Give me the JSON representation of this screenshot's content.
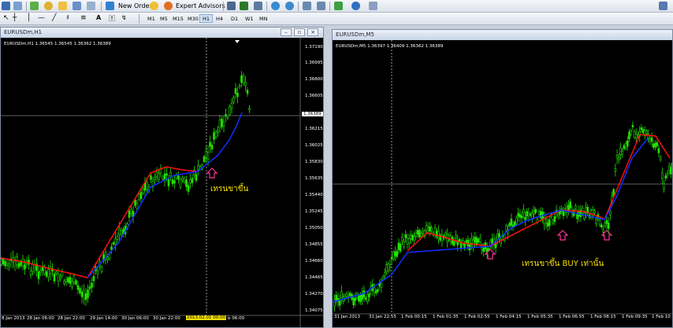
{
  "toolbar": {
    "new_order_label": "New Order",
    "expert_advisors_label": "Expert Advisors",
    "timeframes": [
      "M1",
      "M5",
      "M15",
      "M30",
      "H1",
      "H4",
      "D1",
      "W1",
      "MN"
    ]
  },
  "left_window": {
    "title": "EURUSDm,H1",
    "info": "EURUSDm,H1  1.36545 1.36545 1.36362 1.36389",
    "current_price": "1.36389",
    "price_axis": [
      "1.37190",
      "1.36995",
      "1.36800",
      "1.36605",
      "1.36215",
      "1.36025",
      "1.35830",
      "1.35635",
      "1.35440",
      "1.35245",
      "1.35050",
      "1.34855",
      "1.34660",
      "1.34465",
      "1.34270",
      "1.34075"
    ],
    "time_axis": [
      "8 Jan 2013",
      "28 Jan 06:00",
      "28 Jan 22:00",
      "29 Jan 14:00",
      "30 Jan 06:00",
      "30 Jan 22:00"
    ],
    "time_highlight": "2013.02.01 00:00",
    "time_tail": "b 06:00",
    "annotation": "เทรนขาขึ้น"
  },
  "right_window": {
    "title": "EURUSDm,M5",
    "info": "EURUSDm,M5  1.36397 1.36409 1.36362 1.36389",
    "time_axis": [
      "31 Jan 2013",
      "31 Jan 22:55",
      "1 Feb 00:15",
      "1 Feb 01:35",
      "1 Feb 02:55",
      "1 Feb 04:15",
      "1 Feb 05:35",
      "1 Feb 06:55",
      "1 Feb 08:15",
      "1 Feb 09:35",
      "1 Feb 10"
    ],
    "annotation": "เทรนขาขึ้น BUY เท่านั้น"
  },
  "colors": {
    "candles": "#22e000",
    "ma_up": "#1030ff",
    "ma_down": "#ff1010",
    "arrow": "#ff3399",
    "grid": "#ffffff"
  }
}
